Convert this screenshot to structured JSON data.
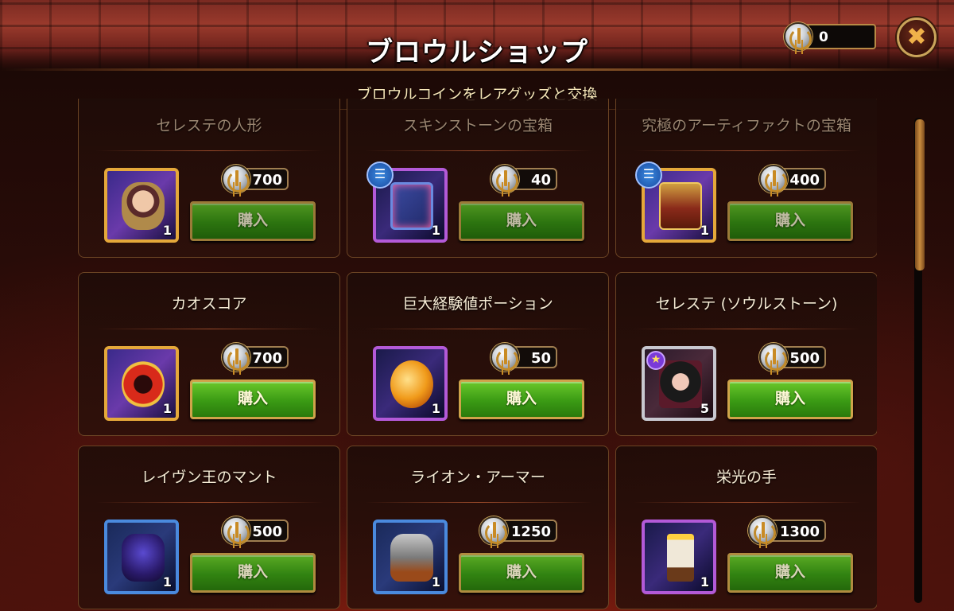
{
  "header": {
    "title": "ブロウルショップ",
    "subtitle": "ブロウルコインをレアグッズと交換",
    "currency_amount": "0",
    "close_icon": "close-x-icon"
  },
  "shop": {
    "items": [
      {
        "name": "セレステの人形",
        "price": "700",
        "quantity": "1",
        "buy_label": "購入",
        "frame": "gold",
        "art": "doll",
        "badge": ""
      },
      {
        "name": "スキンストーンの宝箱",
        "price": "40",
        "quantity": "1",
        "buy_label": "購入",
        "frame": "purple",
        "art": "box",
        "badge": "info"
      },
      {
        "name": "究極のアーティファクトの宝箱",
        "price": "400",
        "quantity": "1",
        "buy_label": "購入",
        "frame": "gold",
        "art": "chest",
        "badge": "info"
      },
      {
        "name": "カオスコア",
        "price": "700",
        "quantity": "1",
        "buy_label": "購入",
        "frame": "gold",
        "art": "ring",
        "badge": ""
      },
      {
        "name": "巨大経験値ポーション",
        "price": "50",
        "quantity": "1",
        "buy_label": "購入",
        "frame": "purple",
        "art": "potion",
        "badge": ""
      },
      {
        "name": "セレステ (ソウルストーン)",
        "price": "500",
        "quantity": "5",
        "buy_label": "購入",
        "frame": "silver",
        "art": "hero",
        "badge": "star"
      },
      {
        "name": "レイヴン王のマント",
        "price": "500",
        "quantity": "1",
        "buy_label": "購入",
        "frame": "blue",
        "art": "cloak",
        "badge": ""
      },
      {
        "name": "ライオン・アーマー",
        "price": "1250",
        "quantity": "1",
        "buy_label": "購入",
        "frame": "blue",
        "art": "armor",
        "badge": ""
      },
      {
        "name": "栄光の手",
        "price": "1300",
        "quantity": "1",
        "buy_label": "購入",
        "frame": "purple",
        "art": "candle",
        "badge": ""
      }
    ]
  },
  "colors": {
    "buy_button": "#3a9a14",
    "frame_gold": "#e5a83a",
    "frame_purple": "#b35ad8",
    "frame_blue": "#4a8ade",
    "frame_silver": "#c8c8d0"
  }
}
